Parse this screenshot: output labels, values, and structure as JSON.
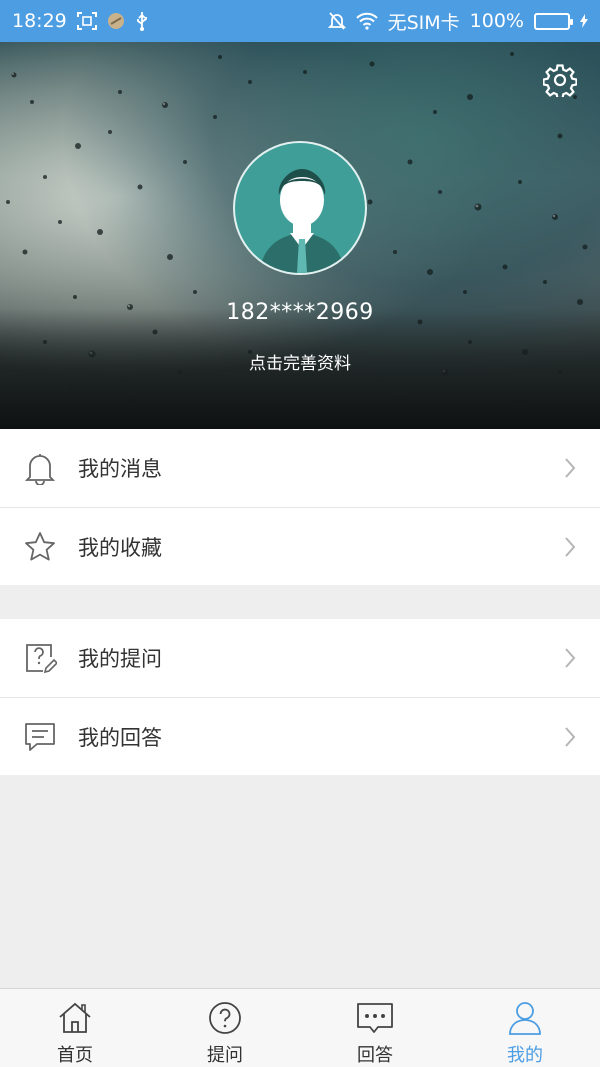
{
  "status_bar": {
    "time": "18:29",
    "carrier": "无SIM卡",
    "battery": "100%"
  },
  "profile": {
    "phone": "182****2969",
    "complete_prompt": "点击完善资料"
  },
  "menu_group_1": [
    {
      "label": "我的消息",
      "icon": "bell-icon"
    },
    {
      "label": "我的收藏",
      "icon": "star-icon"
    }
  ],
  "menu_group_2": [
    {
      "label": "我的提问",
      "icon": "question-edit-icon"
    },
    {
      "label": "我的回答",
      "icon": "chat-message-icon"
    }
  ],
  "tabs": [
    {
      "label": "首页",
      "icon": "home-icon",
      "active": false
    },
    {
      "label": "提问",
      "icon": "question-circle-icon",
      "active": false
    },
    {
      "label": "回答",
      "icon": "chat-dots-icon",
      "active": false
    },
    {
      "label": "我的",
      "icon": "user-icon",
      "active": true
    }
  ],
  "colors": {
    "accent": "#4d9de3",
    "status_bar": "#4d9de3",
    "avatar_bg": "#3f9e97",
    "battery_fill": "#5ef05e"
  }
}
